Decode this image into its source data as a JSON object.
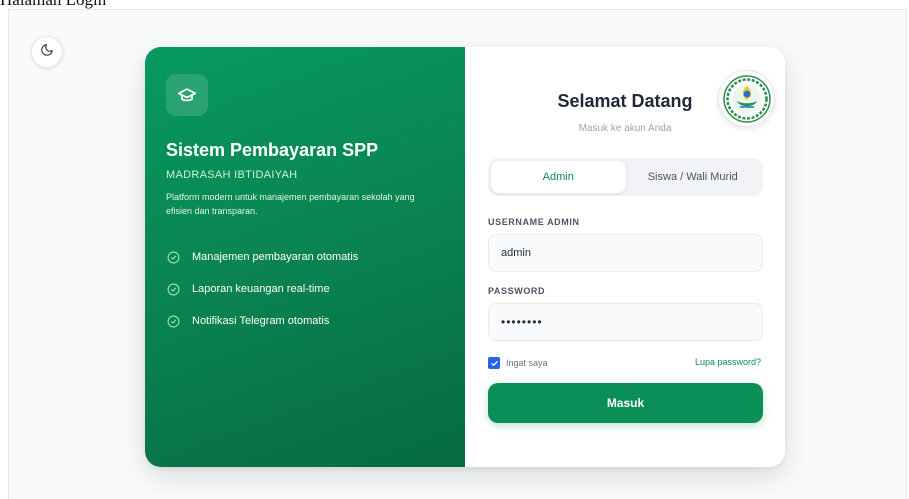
{
  "page": {
    "heading": "Halaman Login"
  },
  "colors": {
    "brand_green": "#0a8f56",
    "accent_blue": "#2563eb"
  },
  "theme_toggle": {
    "icon": "moon-icon"
  },
  "left_panel": {
    "icon": "graduation-cap-icon",
    "title": "Sistem Pembayaran SPP",
    "subtitle": "MADRASAH IBTIDAIYAH",
    "description": "Platform modern untuk manajemen pembayaran sekolah yang efisien dan transparan.",
    "features": [
      {
        "icon": "check-circle-icon",
        "label": "Manajemen pembayaran otomatis"
      },
      {
        "icon": "check-circle-icon",
        "label": "Laporan keuangan real-time"
      },
      {
        "icon": "check-circle-icon",
        "label": "Notifikasi Telegram otomatis"
      }
    ]
  },
  "login": {
    "logo": "school-emblem-logo",
    "title": "Selamat Datang",
    "subtitle": "Masuk ke akun Anda",
    "tabs": [
      {
        "label": "Admin",
        "active": true
      },
      {
        "label": "Siswa / Wali Murid",
        "active": false
      }
    ],
    "username_label": "USERNAME ADMIN",
    "username_value": "admin",
    "password_label": "PASSWORD",
    "password_value": "••••••••",
    "remember_label": "Ingat saya",
    "remember_checked": true,
    "forgot_label": "Lupa password?",
    "submit_label": "Masuk"
  }
}
